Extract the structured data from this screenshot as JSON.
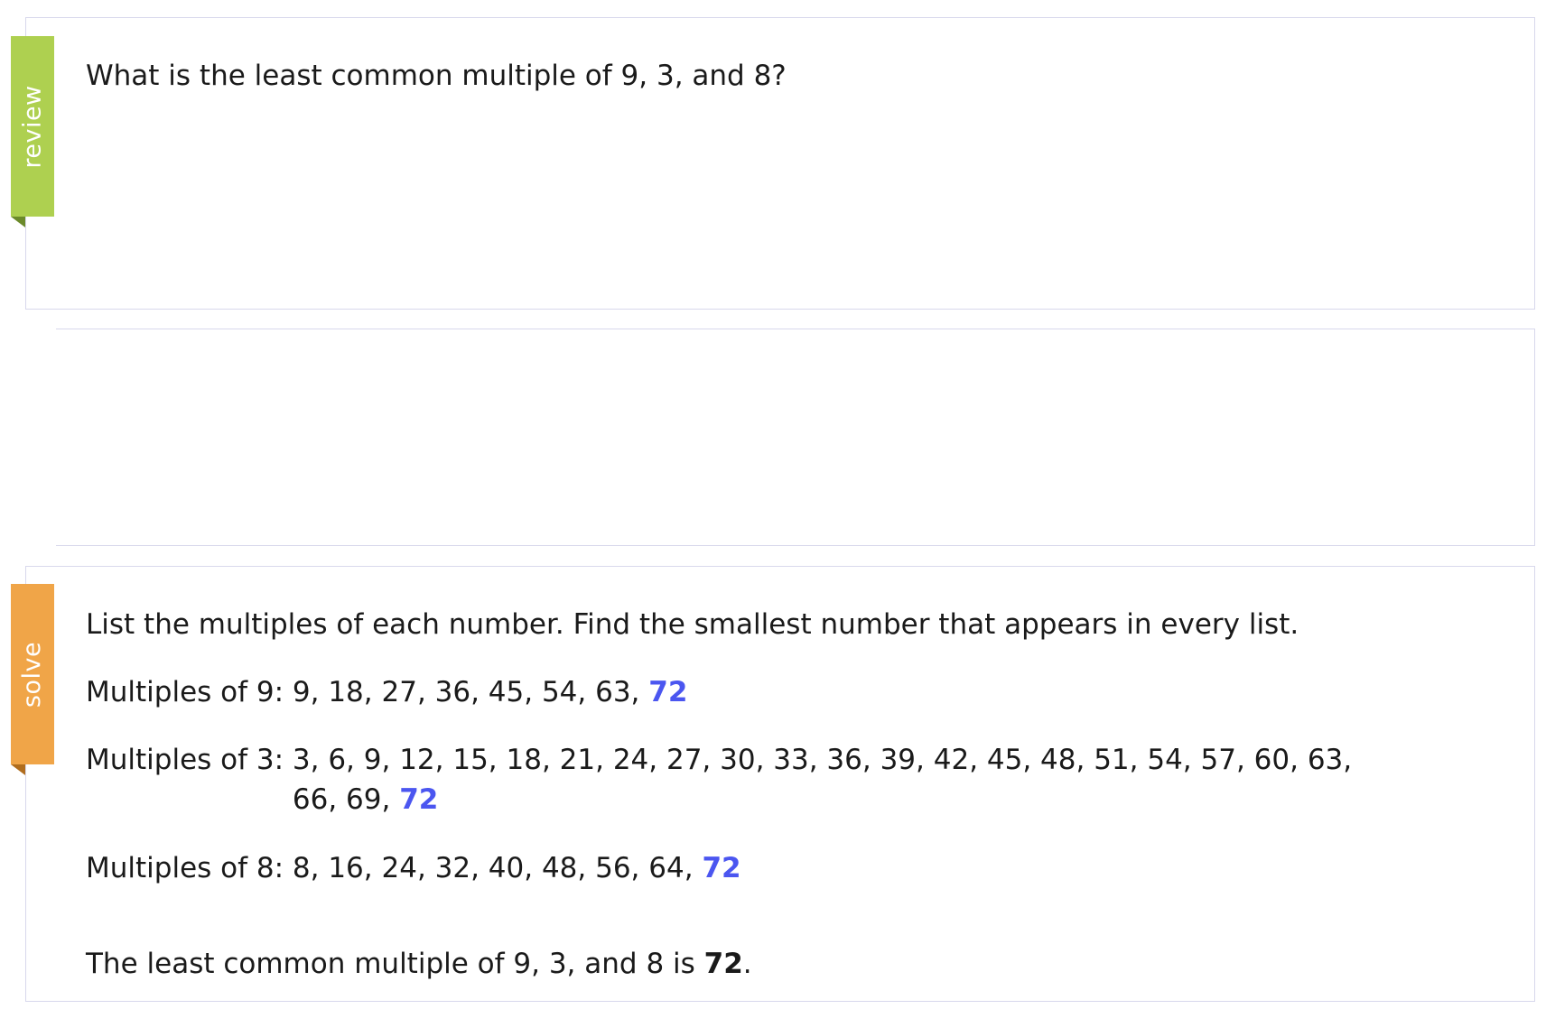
{
  "review": {
    "tag": "review",
    "question": "What is the least common multiple of 9, 3, and 8?"
  },
  "solve": {
    "tag": "solve",
    "instruction": "List the multiples of each number. Find the smallest number that appears in every list.",
    "rows": [
      {
        "label": "Multiples of 9:",
        "values": "9, 18, 27, 36, 45, 54, 63,",
        "answer": "72"
      },
      {
        "label": "Multiples of 3:",
        "values_line1": "3, 6, 9, 12, 15, 18, 21, 24, 27, 30, 33, 36, 39, 42, 45, 48, 51, 54, 57, 60, 63,",
        "values_line2": "66, 69,",
        "answer": "72"
      },
      {
        "label": "Multiples of 8:",
        "values": "8, 16, 24, 32, 40, 48, 56, 64,",
        "answer": "72"
      }
    ],
    "conclusion_prefix": "The least common multiple of 9, 3, and 8 is",
    "conclusion_answer": "72",
    "conclusion_suffix": "."
  },
  "colors": {
    "review_ribbon": "#aed050",
    "solve_ribbon": "#f0a548",
    "highlight": "#4b56f0",
    "card_border": "#d8d8ec"
  }
}
